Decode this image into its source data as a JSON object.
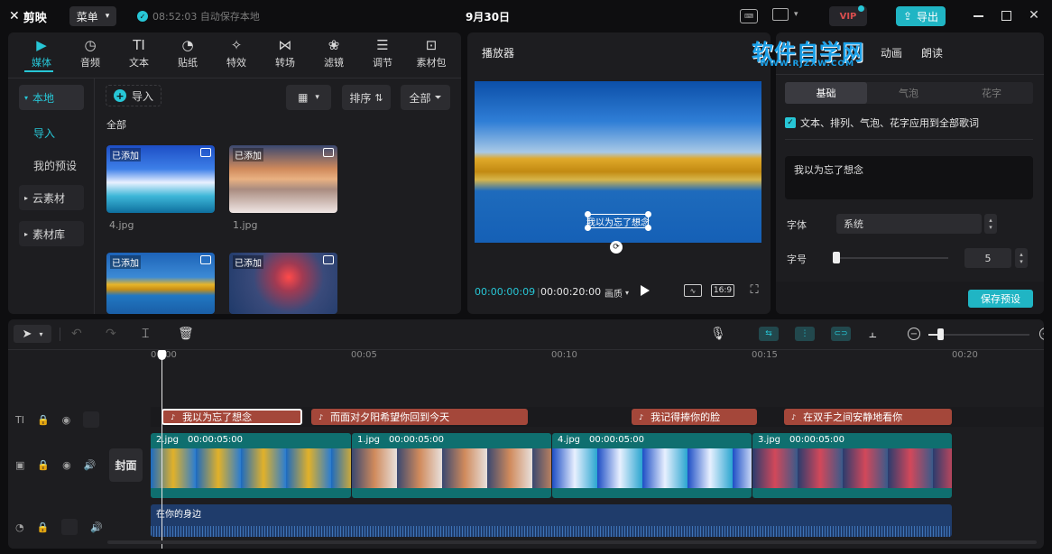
{
  "app": {
    "logo_text": "剪映",
    "menu_label": "菜单",
    "autosave": "08:52:03 自动保存本地",
    "project_title": "9月30日",
    "vip_label": "VIP",
    "export_label": "导出"
  },
  "toolbar": {
    "items": [
      {
        "label": "媒体",
        "icon": "media-icon"
      },
      {
        "label": "音频",
        "icon": "audio-icon"
      },
      {
        "label": "文本",
        "icon": "text-icon"
      },
      {
        "label": "贴纸",
        "icon": "sticker-icon"
      },
      {
        "label": "特效",
        "icon": "effects-icon"
      },
      {
        "label": "转场",
        "icon": "transition-icon"
      },
      {
        "label": "滤镜",
        "icon": "filter-icon"
      },
      {
        "label": "调节",
        "icon": "adjust-icon"
      },
      {
        "label": "素材包",
        "icon": "package-icon"
      }
    ]
  },
  "sidebar": {
    "local": "本地",
    "import": "导入",
    "presets": "我的预设",
    "cloud": "云素材",
    "library": "素材库"
  },
  "media": {
    "import_label": "导入",
    "sort_label": "排序",
    "filter_label": "全部",
    "section_label": "全部",
    "items": [
      {
        "name": "4.jpg",
        "badge": "已添加"
      },
      {
        "name": "1.jpg",
        "badge": "已添加"
      },
      {
        "name": "",
        "badge": "已添加"
      },
      {
        "name": "",
        "badge": "已添加"
      }
    ]
  },
  "player": {
    "title": "播放器",
    "subtitle_text": "我以为忘了想念",
    "current_time": "00:00:00:09",
    "total_time": "00:00:20:00",
    "quality_label": "画质",
    "ratio_label": "16:9"
  },
  "inspector": {
    "tab_animation": "动画",
    "tab_read": "朗读",
    "watermark": "软件自学网",
    "watermark_url": "WWW.RJZXW.COM",
    "subtabs": [
      "基础",
      "气泡",
      "花字"
    ],
    "apply_all": "文本、排列、气泡、花字应用到全部歌词",
    "text_value": "我以为忘了想念",
    "font_label": "字体",
    "font_value": "系统",
    "size_label": "字号",
    "size_value": "5",
    "save_preset": "保存预设"
  },
  "timeline": {
    "ruler": [
      "00:00",
      "00:05",
      "00:10",
      "00:15",
      "00:20"
    ],
    "cover_label": "封面",
    "lyrics": [
      {
        "text": "我以为忘了想念"
      },
      {
        "text": "而面对夕阳希望你回到今天"
      },
      {
        "text": "我记得捧你的脸"
      },
      {
        "text": "在双手之间安静地看你"
      }
    ],
    "clips": [
      {
        "name": "2.jpg",
        "duration": "00:00:05:00"
      },
      {
        "name": "1.jpg",
        "duration": "00:00:05:00"
      },
      {
        "name": "4.jpg",
        "duration": "00:00:05:00"
      },
      {
        "name": "3.jpg",
        "duration": "00:00:05:00"
      }
    ],
    "audio_label": "在你的身边"
  },
  "colors": {
    "accent": "#27c6d6",
    "lyric_clip": "#a4473a",
    "video_clip": "#0f6f6f",
    "audio_clip": "#1f3c6b"
  }
}
